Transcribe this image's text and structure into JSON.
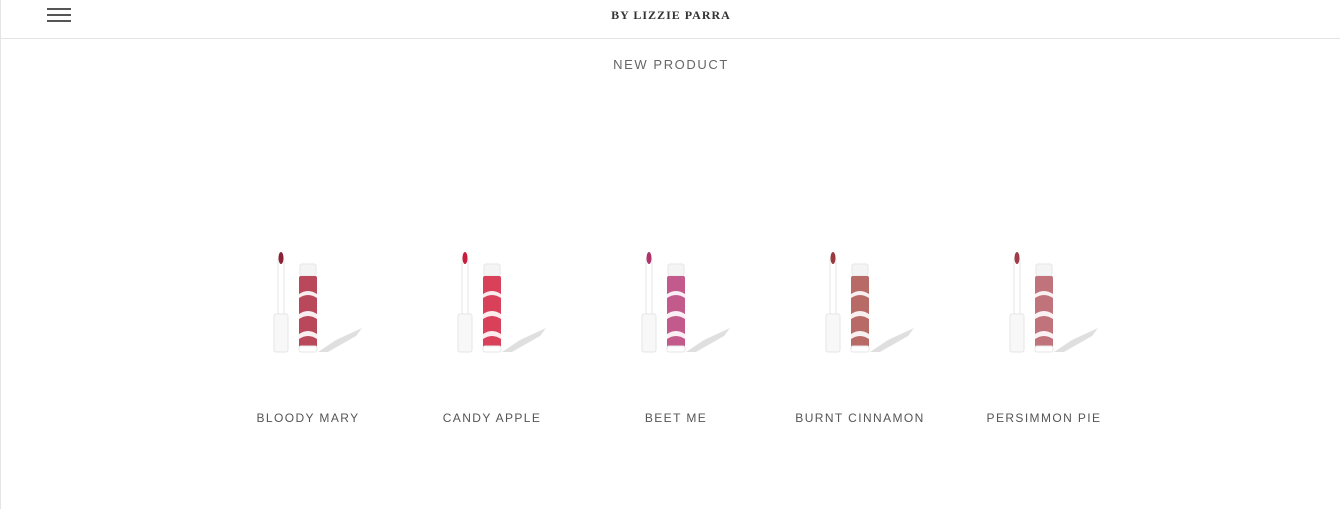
{
  "header": {
    "menu_icon": "hamburger-menu-icon",
    "brand": "BY LIZZIE PARRA"
  },
  "section": {
    "title": "NEW PRODUCT"
  },
  "products": [
    {
      "name": "BLOODY MARY",
      "color": "#8a2238",
      "tube_color": "#b8485a"
    },
    {
      "name": "CANDY APPLE",
      "color": "#c81e3c",
      "tube_color": "#d9405a"
    },
    {
      "name": "BEET ME",
      "color": "#b0336a",
      "tube_color": "#c25a8c"
    },
    {
      "name": "BURNT CINNAMON",
      "color": "#9a3a3f",
      "tube_color": "#b86a66"
    },
    {
      "name": "PERSIMMON PIE",
      "color": "#a03c4a",
      "tube_color": "#c0737a"
    }
  ]
}
